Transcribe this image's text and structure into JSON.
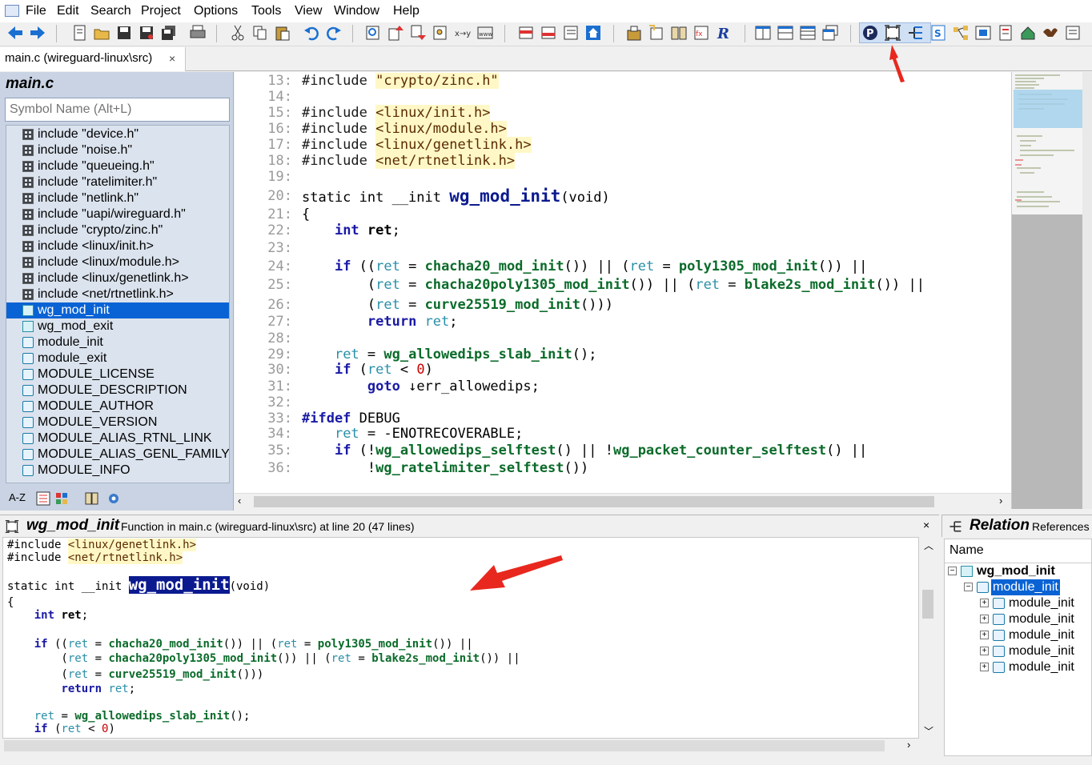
{
  "menubar": {
    "items": [
      "File",
      "Edit",
      "Search",
      "Project",
      "Options",
      "Tools",
      "View",
      "Window",
      "Help"
    ]
  },
  "toolbar": {
    "icons": [
      "back-icon",
      "forward-icon",
      "new-file-icon",
      "open-icon",
      "save-icon",
      "save-as-icon",
      "save-all-icon",
      "print-icon",
      "cut-icon",
      "copy-icon",
      "paste-icon",
      "undo-icon",
      "redo-icon",
      "find-icon",
      "jump-up-icon",
      "jump-down-icon",
      "find-files-icon",
      "replace-icon",
      "web-icon",
      "prev-bookmark-icon",
      "next-bookmark-icon",
      "bookmark-list-icon",
      "home-icon",
      "project-icon",
      "symbol-icon",
      "browse-icon",
      "lookup-icon",
      "r-icon",
      "layout1-icon",
      "layout2-icon",
      "layout3-icon",
      "layout4-icon",
      "project-window-icon",
      "context-window-icon",
      "relation-window-icon",
      "symbol-window-icon",
      "call-graph-icon",
      "class-browser-icon",
      "window-list-icon",
      "sync-icon",
      "dove-icon",
      "options-icon"
    ]
  },
  "tab": {
    "label": "main.c (wireguard-linux\\src)",
    "close": "×"
  },
  "symbol_window": {
    "title": "main.c",
    "search_placeholder": "Symbol Name (Alt+L)",
    "items": [
      {
        "label": "include \"device.h\"",
        "kind": "include"
      },
      {
        "label": "include \"noise.h\"",
        "kind": "include"
      },
      {
        "label": "include \"queueing.h\"",
        "kind": "include"
      },
      {
        "label": "include \"ratelimiter.h\"",
        "kind": "include"
      },
      {
        "label": "include \"netlink.h\"",
        "kind": "include"
      },
      {
        "label": "include \"uapi/wireguard.h\"",
        "kind": "include"
      },
      {
        "label": "include \"crypto/zinc.h\"",
        "kind": "include"
      },
      {
        "label": "include <linux/init.h>",
        "kind": "include"
      },
      {
        "label": "include <linux/module.h>",
        "kind": "include"
      },
      {
        "label": "include <linux/genetlink.h>",
        "kind": "include"
      },
      {
        "label": "include <net/rtnetlink.h>",
        "kind": "include"
      },
      {
        "label": "wg_mod_init",
        "kind": "function",
        "selected": true
      },
      {
        "label": "wg_mod_exit",
        "kind": "function"
      },
      {
        "label": "module_init",
        "kind": "macro"
      },
      {
        "label": "module_exit",
        "kind": "macro"
      },
      {
        "label": "MODULE_LICENSE",
        "kind": "macro"
      },
      {
        "label": "MODULE_DESCRIPTION",
        "kind": "macro"
      },
      {
        "label": "MODULE_AUTHOR",
        "kind": "macro"
      },
      {
        "label": "MODULE_VERSION",
        "kind": "macro"
      },
      {
        "label": "MODULE_ALIAS_RTNL_LINK",
        "kind": "macro"
      },
      {
        "label": "MODULE_ALIAS_GENL_FAMILY",
        "kind": "macro"
      },
      {
        "label": "MODULE_INFO",
        "kind": "macro"
      }
    ],
    "tools": [
      "A-Z"
    ]
  },
  "editor": {
    "lines": [
      {
        "n": "13:",
        "html": "<span class='pp'>#include</span> <span class='str'>\"crypto/zinc.h\"</span>"
      },
      {
        "n": "14:",
        "html": ""
      },
      {
        "n": "15:",
        "html": "<span class='pp'>#include</span> <span class='str'>&lt;linux/init.h&gt;</span>"
      },
      {
        "n": "16:",
        "html": "<span class='pp'>#include</span> <span class='str'>&lt;linux/module.h&gt;</span>"
      },
      {
        "n": "17:",
        "html": "<span class='pp'>#include</span> <span class='str'>&lt;linux/genetlink.h&gt;</span>"
      },
      {
        "n": "18:",
        "html": "<span class='pp'>#include</span> <span class='str'>&lt;net/rtnetlink.h&gt;</span>"
      },
      {
        "n": "19:",
        "html": ""
      },
      {
        "n": "20:",
        "html": "static int __init <span class='big-fn'>wg_mod_init</span>(void)"
      },
      {
        "n": "21:",
        "html": "{"
      },
      {
        "n": "22:",
        "html": "    <span class='kw'>int</span> <b>ret</b>;"
      },
      {
        "n": "23:",
        "html": ""
      },
      {
        "n": "24:",
        "html": "    <span class='kw'>if</span> ((<span class='var'>ret</span> = <span class='fn'>chacha20_mod_init</span>()) || (<span class='var'>ret</span> = <span class='fn'>poly1305_mod_init</span>()) ||"
      },
      {
        "n": "25:",
        "html": "        (<span class='var'>ret</span> = <span class='fn'>chacha20poly1305_mod_init</span>()) || (<span class='var'>ret</span> = <span class='fn'>blake2s_mod_init</span>()) ||"
      },
      {
        "n": "26:",
        "html": "        (<span class='var'>ret</span> = <span class='fn'>curve25519_mod_init</span>()))"
      },
      {
        "n": "27:",
        "html": "        <span class='kw'>return</span> <span class='var'>ret</span>;"
      },
      {
        "n": "28:",
        "html": ""
      },
      {
        "n": "29:",
        "html": "    <span class='var'>ret</span> = <span class='fn'>wg_allowedips_slab_init</span>();"
      },
      {
        "n": "30:",
        "html": "    <span class='kw'>if</span> (<span class='var'>ret</span> &lt; <span class='num'>0</span>)"
      },
      {
        "n": "31:",
        "html": "        <span class='kw'>goto</span> ↓err_allowedips;"
      },
      {
        "n": "32:",
        "html": ""
      },
      {
        "n": "33:",
        "html": "<span class='kw'>#ifdef</span> DEBUG"
      },
      {
        "n": "34:",
        "html": "    <span class='var'>ret</span> = -ENOTRECOVERABLE;"
      },
      {
        "n": "35:",
        "html": "    <span class='kw'>if</span> (!<span class='fn'>wg_allowedips_selftest</span>() || !<span class='fn'>wg_packet_counter_selftest</span>() ||"
      },
      {
        "n": "36:",
        "html": "        !<span class='fn'>wg_ratelimiter_selftest</span>())"
      }
    ]
  },
  "context_window": {
    "title": "wg_mod_init",
    "subtitle": "Function in main.c (wireguard-linux\\src) at line 20 (47 lines)",
    "close": "×",
    "lines": [
      {
        "html": "#include <span class='str'>&lt;linux/genetlink.h&gt;</span>"
      },
      {
        "html": "#include <span class='str'>&lt;net/rtnetlink.h&gt;</span>"
      },
      {
        "html": ""
      },
      {
        "html": "static int __init <span class='cx-sel'>wg_mod_init</span>(void)"
      },
      {
        "html": "{"
      },
      {
        "html": "    <span class='kw'>int</span> <b>ret</b>;"
      },
      {
        "html": ""
      },
      {
        "html": "    <span class='kw'>if</span> ((<span class='var'>ret</span> = <span class='fn'>chacha20_mod_init</span>()) || (<span class='var'>ret</span> = <span class='fn'>poly1305_mod_init</span>()) ||"
      },
      {
        "html": "        (<span class='var'>ret</span> = <span class='fn'>chacha20poly1305_mod_init</span>()) || (<span class='var'>ret</span> = <span class='fn'>blake2s_mod_init</span>()) ||"
      },
      {
        "html": "        (<span class='var'>ret</span> = <span class='fn'>curve25519_mod_init</span>()))"
      },
      {
        "html": "        <span class='kw'>return</span> <span class='var'>ret</span>;"
      },
      {
        "html": ""
      },
      {
        "html": "    <span class='var'>ret</span> = <span class='fn'>wg_allowedips_slab_init</span>();"
      },
      {
        "html": "    <span class='kw'>if</span> (<span class='var'>ret</span> &lt; <span class='num'>0</span>)"
      }
    ]
  },
  "relation_window": {
    "title": "Relation",
    "subtitle": "References",
    "column_header": "Name",
    "tree": [
      {
        "label": "wg_mod_init",
        "depth": 0,
        "expander": "−",
        "bold": true
      },
      {
        "label": "module_init",
        "depth": 1,
        "expander": "−",
        "selected": true
      },
      {
        "label": "module_init",
        "depth": 2,
        "expander": "+"
      },
      {
        "label": "module_init",
        "depth": 2,
        "expander": "+"
      },
      {
        "label": "module_init",
        "depth": 2,
        "expander": "+"
      },
      {
        "label": "module_init",
        "depth": 2,
        "expander": "+"
      },
      {
        "label": "module_init",
        "depth": 2,
        "expander": "+"
      }
    ]
  },
  "colors": {
    "selection": "#0a63d4",
    "annotation_arrow": "#e8281e",
    "symbol_panel_bg": "#c9d3e3"
  }
}
